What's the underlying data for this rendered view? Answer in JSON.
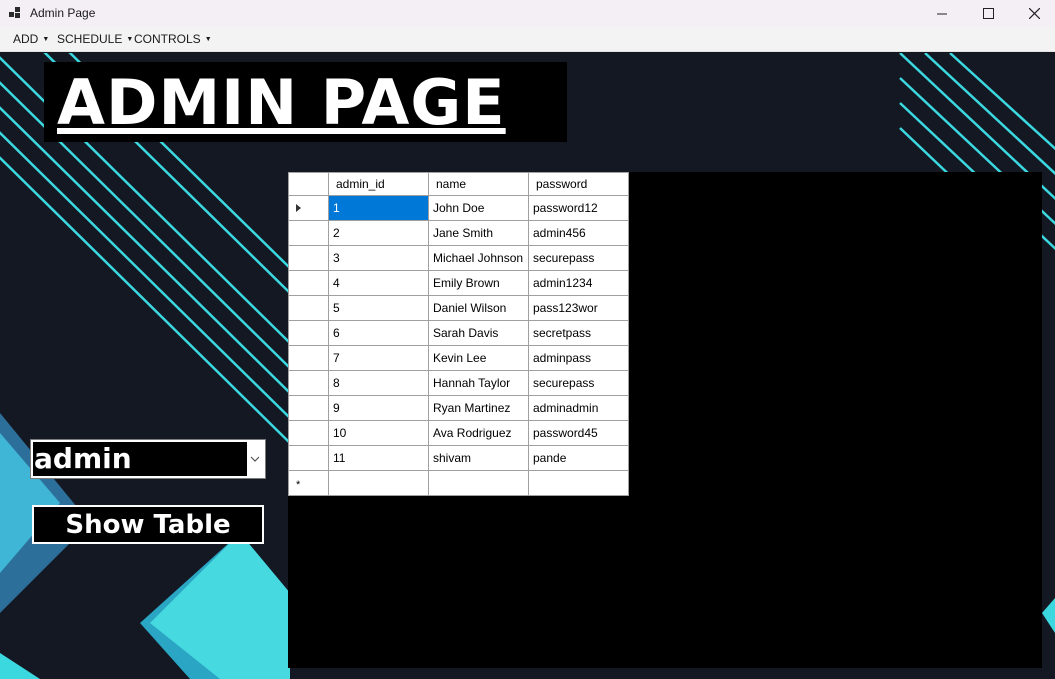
{
  "window": {
    "title": "Admin Page"
  },
  "menu": {
    "items": [
      {
        "label": "ADD"
      },
      {
        "label": "SCHEDULE"
      },
      {
        "label": "CONTROLS"
      }
    ]
  },
  "header": {
    "title": "ADMIN PAGE"
  },
  "table_select": {
    "value": "admin"
  },
  "show_button": {
    "label": "Show Table"
  },
  "grid": {
    "columns": [
      "admin_id",
      "name",
      "password"
    ],
    "rows": [
      [
        "1",
        "John Doe",
        "password12"
      ],
      [
        "2",
        "Jane Smith",
        "admin456"
      ],
      [
        "3",
        "Michael Johnson",
        "securepass"
      ],
      [
        "4",
        "Emily Brown",
        "admin1234"
      ],
      [
        "5",
        "Daniel Wilson",
        "pass123wor"
      ],
      [
        "6",
        "Sarah Davis",
        "secretpass"
      ],
      [
        "7",
        "Kevin Lee",
        "adminpass"
      ],
      [
        "8",
        "Hannah Taylor",
        "securepass"
      ],
      [
        "9",
        "Ryan Martinez",
        "adminadmin"
      ],
      [
        "10",
        "Ava Rodriguez",
        "password45"
      ],
      [
        "11",
        "shivam",
        "pande"
      ]
    ],
    "new_row_marker": "*"
  },
  "colors": {
    "background": "#141823",
    "accent_cyan": "#3bd8e0",
    "selection": "#0078d7"
  }
}
